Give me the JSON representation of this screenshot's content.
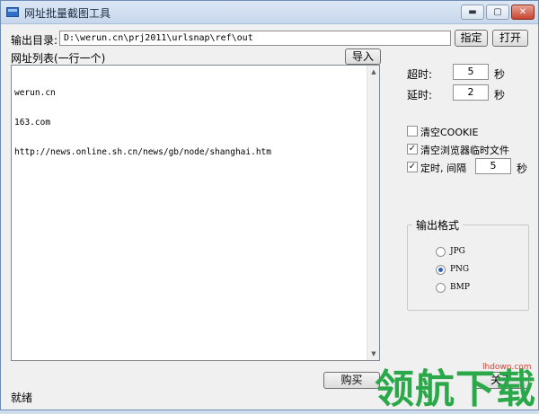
{
  "window": {
    "title": "网址批量截图工具"
  },
  "caption_buttons": {
    "minimize": "▬",
    "maximize": "▢",
    "close": "✕"
  },
  "output": {
    "label": "输出目录:",
    "path": "D:\\werun.cn\\prj2011\\urlsnap\\ref\\out",
    "browse_button": "指定",
    "open_button": "打开"
  },
  "url_list": {
    "label": "网址列表(一行一个)",
    "import_button": "导入",
    "lines": [
      "werun.cn",
      "163.com",
      "http://news.online.sh.cn/news/gb/node/shanghai.htm"
    ]
  },
  "timeout": {
    "label": "超时:",
    "value": "5",
    "unit": "秒"
  },
  "delay": {
    "label": "延时:",
    "value": "2",
    "unit": "秒"
  },
  "options": {
    "clear_cookie": {
      "label": "清空COOKIE",
      "checked": false
    },
    "clear_temp": {
      "label": "清空浏览器临时文件",
      "checked": true
    },
    "timer": {
      "label": "定时, 间隔",
      "checked": true,
      "value": "5",
      "unit": "秒"
    }
  },
  "format": {
    "title": "输出格式",
    "options": [
      "JPG",
      "PNG",
      "BMP"
    ],
    "selected": "PNG"
  },
  "bottom": {
    "buy_button": "购买",
    "about_button": "关于"
  },
  "status": "就绪",
  "watermark": {
    "text": "领航下载",
    "site": "lhdown.com"
  },
  "colors": {
    "accent": "#2c62b8",
    "watermark_green": "#2aa84a",
    "watermark_red": "#e23b2c"
  }
}
